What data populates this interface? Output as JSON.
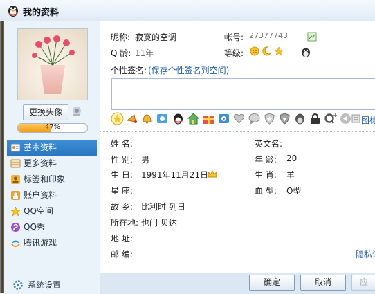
{
  "window": {
    "title": "我的资料"
  },
  "sidebar": {
    "change_avatar_label": "更换头像",
    "profile_progress_text": "47%",
    "profile_progress_value": 0.47,
    "items": [
      {
        "label": "基本资料",
        "icon": "id-card-icon",
        "active": true
      },
      {
        "label": "更多资料",
        "icon": "more-info-icon"
      },
      {
        "label": "标签和印象",
        "icon": "tag-icon"
      },
      {
        "label": "账户资料",
        "icon": "account-icon"
      },
      {
        "label": "QQ空间",
        "icon": "qzone-icon"
      },
      {
        "label": "QQ秀",
        "icon": "qqshow-icon"
      },
      {
        "label": "腾讯游戏",
        "icon": "games-icon"
      }
    ],
    "settings_label": "系统设置"
  },
  "profile": {
    "nickname_label": "昵称:",
    "nickname": "寂寞的空调",
    "account_label": "帐号:",
    "account": "27377743",
    "qage_label": "Q 龄:",
    "qage": "11年",
    "level_label": "等级:",
    "signature_label": "个性签名:",
    "signature_link": "(保存个性签名到空间)",
    "signature_value": "",
    "graffiti_label": "图标"
  },
  "fields": {
    "name": {
      "label": "姓    名:",
      "value": ""
    },
    "english_name": {
      "label": "英文名:",
      "value": ""
    },
    "gender": {
      "label": "性    别:",
      "value": "男"
    },
    "age": {
      "label": "年    龄:",
      "value": "20"
    },
    "birthday": {
      "label": "生    日:",
      "value": "1991年11月21日"
    },
    "zodiac": {
      "label": "生    肖:",
      "value": "羊"
    },
    "constellation": {
      "label": "星    座:",
      "value": ""
    },
    "blood_type": {
      "label": "血    型:",
      "value": "O型"
    },
    "hometown": {
      "label": "故    乡:",
      "value": "比利时  列日"
    },
    "location": {
      "label": "所在地:",
      "value": "也门  贝达"
    },
    "address": {
      "label": "地    址:",
      "value": ""
    },
    "postcode": {
      "label": "邮    编:",
      "value": ""
    },
    "privacy_link": "隐私设"
  },
  "buttons": {
    "ok": "确定",
    "cancel": "取消",
    "apply": "应"
  },
  "colors": {
    "accent": "#2b76c2",
    "link": "#1f5fa8",
    "progress": "#f39b18"
  }
}
